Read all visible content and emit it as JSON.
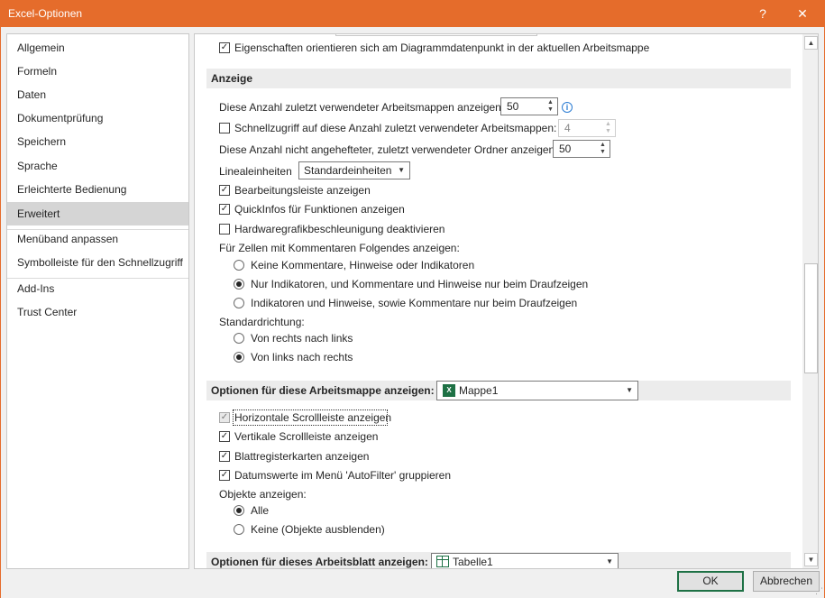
{
  "window": {
    "title": "Excel-Optionen",
    "help": "?",
    "close": "✕",
    "accent": "#e56c2b"
  },
  "sidebar": {
    "items": [
      {
        "label": "Allgemein"
      },
      {
        "label": "Formeln"
      },
      {
        "label": "Daten"
      },
      {
        "label": "Dokumentprüfung"
      },
      {
        "label": "Speichern"
      },
      {
        "label": "Sprache"
      },
      {
        "label": "Erleichterte Bedienung"
      },
      {
        "label": "Erweitert",
        "selected": true
      },
      {
        "label": "Menüband anpassen"
      },
      {
        "label": "Symbolleiste für den Schnellzugriff"
      },
      {
        "label": "Add-Ins"
      },
      {
        "label": "Trust Center"
      }
    ]
  },
  "content": {
    "chart_props_checkbox": {
      "label": "Eigenschaften orientieren sich am Diagrammdatenpunkt in der aktuellen Arbeitsmappe",
      "checked": true
    },
    "anzeige": {
      "heading": "Anzeige",
      "recent_workbooks": {
        "label": "Diese Anzahl zuletzt verwendeter Arbeitsmappen anzeigen:",
        "value": "50"
      },
      "quick_access": {
        "label": "Schnellzugriff auf diese Anzahl zuletzt verwendeter Arbeitsmappen:",
        "value": "4",
        "checked": false
      },
      "unpinned_folders": {
        "label": "Diese Anzahl nicht angehefteter, zuletzt verwendeter Ordner anzeigen:",
        "value": "50"
      },
      "ruler_units": {
        "label": "Linealeinheiten",
        "value": "Standardeinheiten"
      },
      "checkboxes": [
        {
          "label": "Bearbeitungsleiste anzeigen",
          "checked": true
        },
        {
          "label": "QuickInfos für Funktionen anzeigen",
          "checked": true
        },
        {
          "label": "Hardwaregrafikbeschleunigung deaktivieren",
          "checked": false
        }
      ],
      "comments_label": "Für Zellen mit Kommentaren Folgendes anzeigen:",
      "comments_options": [
        {
          "label": "Keine Kommentare, Hinweise oder Indikatoren",
          "selected": false
        },
        {
          "label": "Nur Indikatoren, und Kommentare und Hinweise nur beim Draufzeigen",
          "selected": true
        },
        {
          "label": "Indikatoren und Hinweise, sowie Kommentare nur beim Draufzeigen",
          "selected": false
        }
      ],
      "direction_label": "Standardrichtung:",
      "direction_options": [
        {
          "label": "Von rechts nach links",
          "selected": false
        },
        {
          "label": "Von links nach rechts",
          "selected": true
        }
      ]
    },
    "workbook": {
      "heading": "Optionen für diese Arbeitsmappe anzeigen:",
      "selected": "Mappe1",
      "checkboxes": [
        {
          "label": "Horizontale Scrollleiste anzeigen",
          "checked": true,
          "disabled": true
        },
        {
          "label": "Vertikale Scrollleiste anzeigen",
          "checked": true
        },
        {
          "label": "Blattregisterkarten anzeigen",
          "checked": true
        },
        {
          "label": "Datumswerte im Menü 'AutoFilter' gruppieren",
          "checked": true
        }
      ],
      "objects_label": "Objekte anzeigen:",
      "objects_options": [
        {
          "label": "Alle",
          "selected": true
        },
        {
          "label": "Keine (Objekte ausblenden)",
          "selected": false
        }
      ]
    },
    "sheet": {
      "heading": "Optionen für dieses Arbeitsblatt anzeigen:",
      "selected": "Tabelle1"
    }
  },
  "footer": {
    "ok": "OK",
    "cancel": "Abbrechen"
  },
  "icons": {
    "check": "✓",
    "info": "i",
    "up": "▲",
    "down": "▼",
    "caret": "▼",
    "excel": "X",
    "grip": "⋰"
  }
}
